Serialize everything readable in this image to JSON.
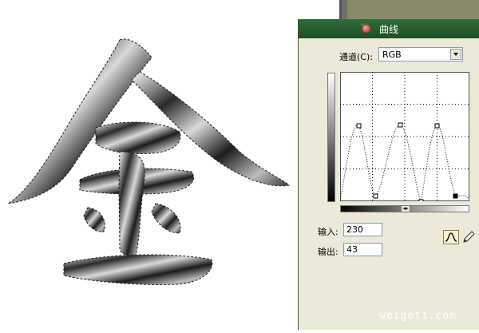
{
  "dialog": {
    "title": "曲线",
    "channel_label": "通道(C):",
    "channel_value": "RGB",
    "input_label": "输入:",
    "input_value": "230",
    "output_label": "输出:",
    "output_value": "43"
  },
  "watermark": "weigeti.com",
  "icons": {
    "app": "apple-icon",
    "curve_tool": "curve-tool-icon",
    "pencil_tool": "pencil-tool-icon",
    "dropdown": "chevron-down-icon"
  },
  "colors": {
    "titlebar": "#2f6c39",
    "dialog_bg": "#ece9d8"
  }
}
